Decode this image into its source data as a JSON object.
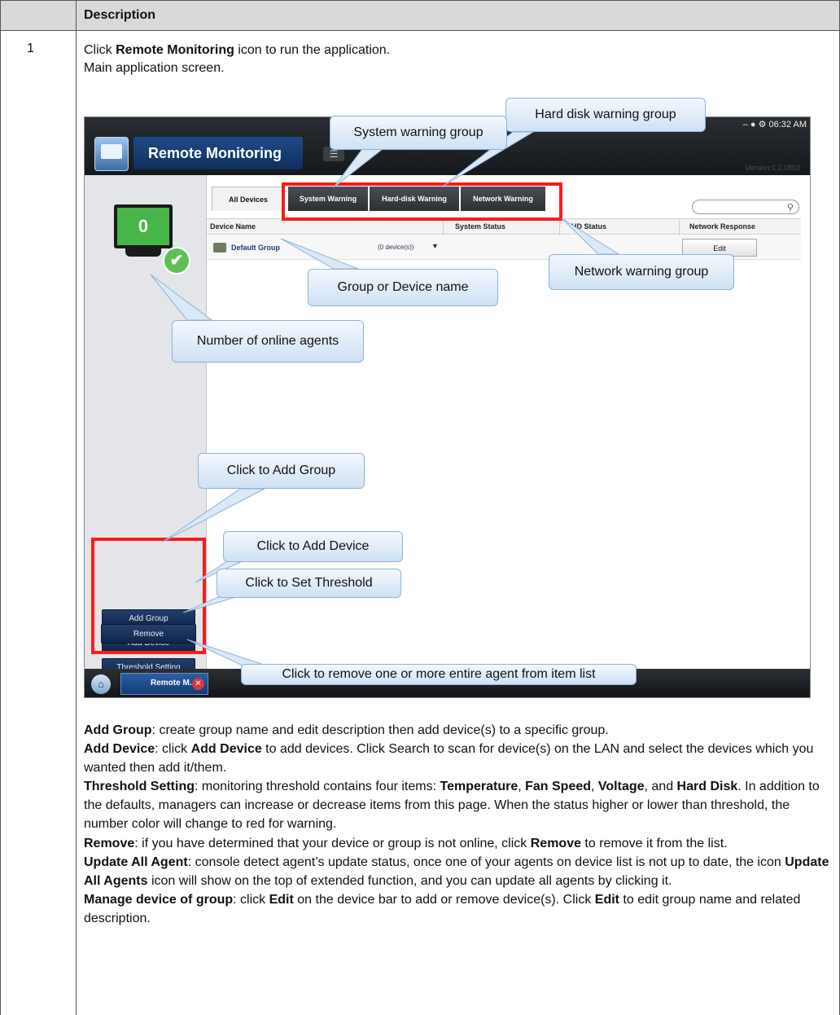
{
  "table": {
    "header": "Description",
    "step": "1",
    "intro_line1_pre": "Click ",
    "intro_line1_bold": "Remote Monitoring",
    "intro_line1_post": " icon to run the application.",
    "intro_line2": "Main application screen."
  },
  "app": {
    "title": "Remote Monitoring",
    "window_status": "– ● ⚙ 06:32 AM",
    "version": "Version:1.2.0802",
    "online_count": "0",
    "tabs": [
      "All Devices",
      "System Warning",
      "Hard-disk Warning",
      "Network Warning"
    ],
    "columns": [
      "Device Name",
      "System Status",
      "HD Status",
      "Network Response"
    ],
    "group_row": {
      "name": "Default Group",
      "count": "(0 device(s))",
      "edit": "Edit"
    },
    "side_buttons": [
      "Add Group",
      "Add Device",
      "Threshold Setting",
      "Remove"
    ],
    "taskbar_item": "Remote M.."
  },
  "callouts": {
    "hard_disk": "Hard disk warning group",
    "system": "System warning group",
    "network": "Network warning group",
    "group_name": "Group or Device name",
    "online_agents": "Number of online agents",
    "add_group": "Click to Add Group",
    "add_device": "Click to Add Device",
    "set_threshold": "Click to Set Threshold",
    "remove": "Click to remove one or more entire agent from item list"
  },
  "body": {
    "p1_bold": "Add Group",
    "p1_text": ": create group name and edit description then add device(s) to a specific group.",
    "p2_bold": "Add Device",
    "p2_text_a": ": click ",
    "p2_bold2": "Add Device",
    "p2_text_b": " to add devices. Click Search to scan for device(s) on the LAN and select the devices which you wanted then add it/them.",
    "p3_bold": "Threshold Setting",
    "p3_text_a": ": monitoring threshold contains four items: ",
    "p3_b_temp": "Temperature",
    "p3_sep1": ", ",
    "p3_b_fan": "Fan Speed",
    "p3_sep2": ", ",
    "p3_b_volt": "Voltage",
    "p3_sep3": ", and ",
    "p3_b_hd": "Hard Disk",
    "p3_text_b": ". In addition to the defaults, managers can increase or decrease items from this page. When the status higher or lower than threshold, the number color will change to red for warning.",
    "p4_bold": "Remove",
    "p4_text_a": ": if you have determined that your device or group is not online, click ",
    "p4_bold2": "Remove",
    "p4_text_b": " to remove it from the list.",
    "p5_bold": "Update All Agent",
    "p5_text_a": ": console detect agent’s update status, once one of your agents on device list is not up to date, the icon ",
    "p5_bold2": "Update All Agents",
    "p5_text_b": " icon will show on the top of extended function, and you can update all agents by clicking it.",
    "p6_bold": "Manage device of group",
    "p6_text_a": ": click ",
    "p6_bold2": "Edit",
    "p6_text_b": " on the device bar to add or remove device(s). Click ",
    "p6_bold3": "Edit",
    "p6_text_c": " to edit group name and related description."
  }
}
